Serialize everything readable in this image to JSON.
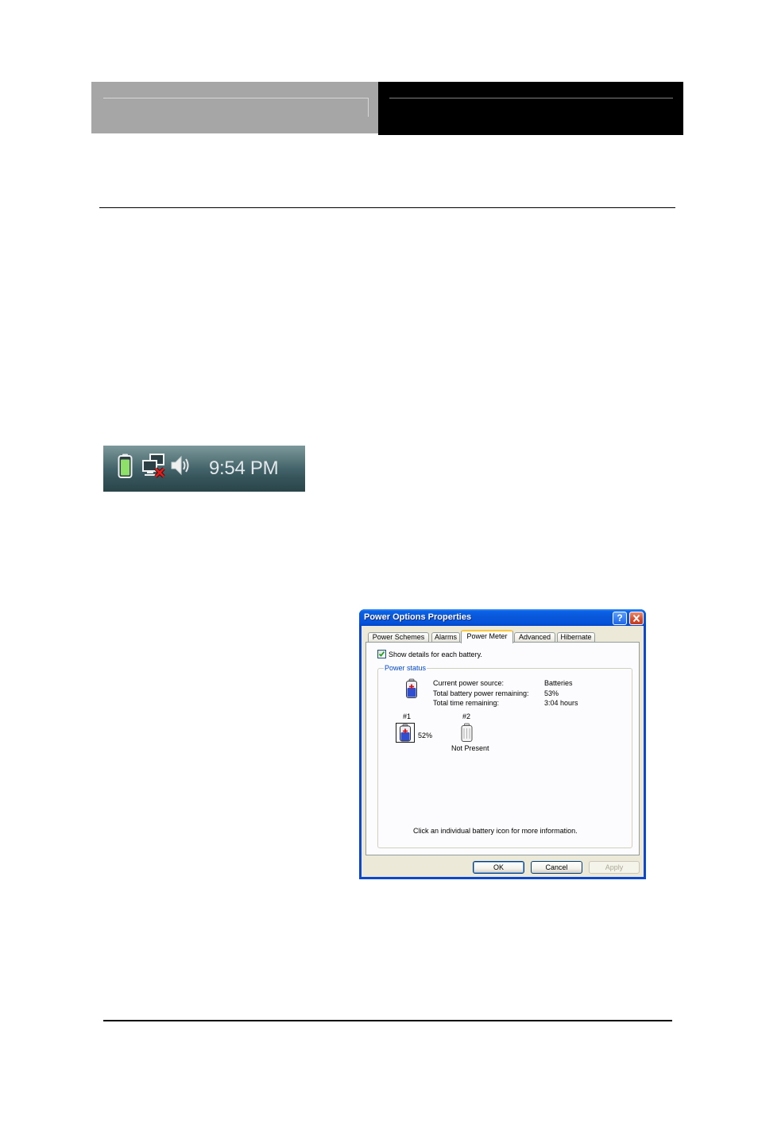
{
  "taskbar": {
    "time": "9:54 PM",
    "icons": [
      "battery-icon",
      "network-disconnected-icon",
      "speaker-icon"
    ]
  },
  "dialog": {
    "title": "Power Options Properties",
    "help_label": "?",
    "tabs": [
      {
        "label": "Power Schemes",
        "selected": false
      },
      {
        "label": "Alarms",
        "selected": false
      },
      {
        "label": "Power Meter",
        "selected": true
      },
      {
        "label": "Advanced",
        "selected": false
      },
      {
        "label": "Hibernate",
        "selected": false
      }
    ],
    "show_details": {
      "label": "Show details for each battery.",
      "checked": true
    },
    "power_status": {
      "title": "Power status",
      "rows": [
        {
          "label": "Current power source:",
          "value": "Batteries"
        },
        {
          "label": "Total battery power remaining:",
          "value": "53%"
        },
        {
          "label": "Total time remaining:",
          "value": "3:04 hours"
        }
      ],
      "batteries": [
        {
          "number": "#1",
          "status": "52%"
        },
        {
          "number": "#2",
          "status": "Not Present"
        }
      ],
      "hint": "Click an individual battery icon for more information."
    },
    "buttons": [
      {
        "label": "OK",
        "disabled": false
      },
      {
        "label": "Cancel",
        "disabled": false
      },
      {
        "label": "Apply",
        "disabled": true
      }
    ]
  },
  "colors": {
    "titlebar": "#0a56d8",
    "close": "#d6492a",
    "group_title": "#0046d5",
    "face": "#ece9d8",
    "check": "#21a121"
  }
}
